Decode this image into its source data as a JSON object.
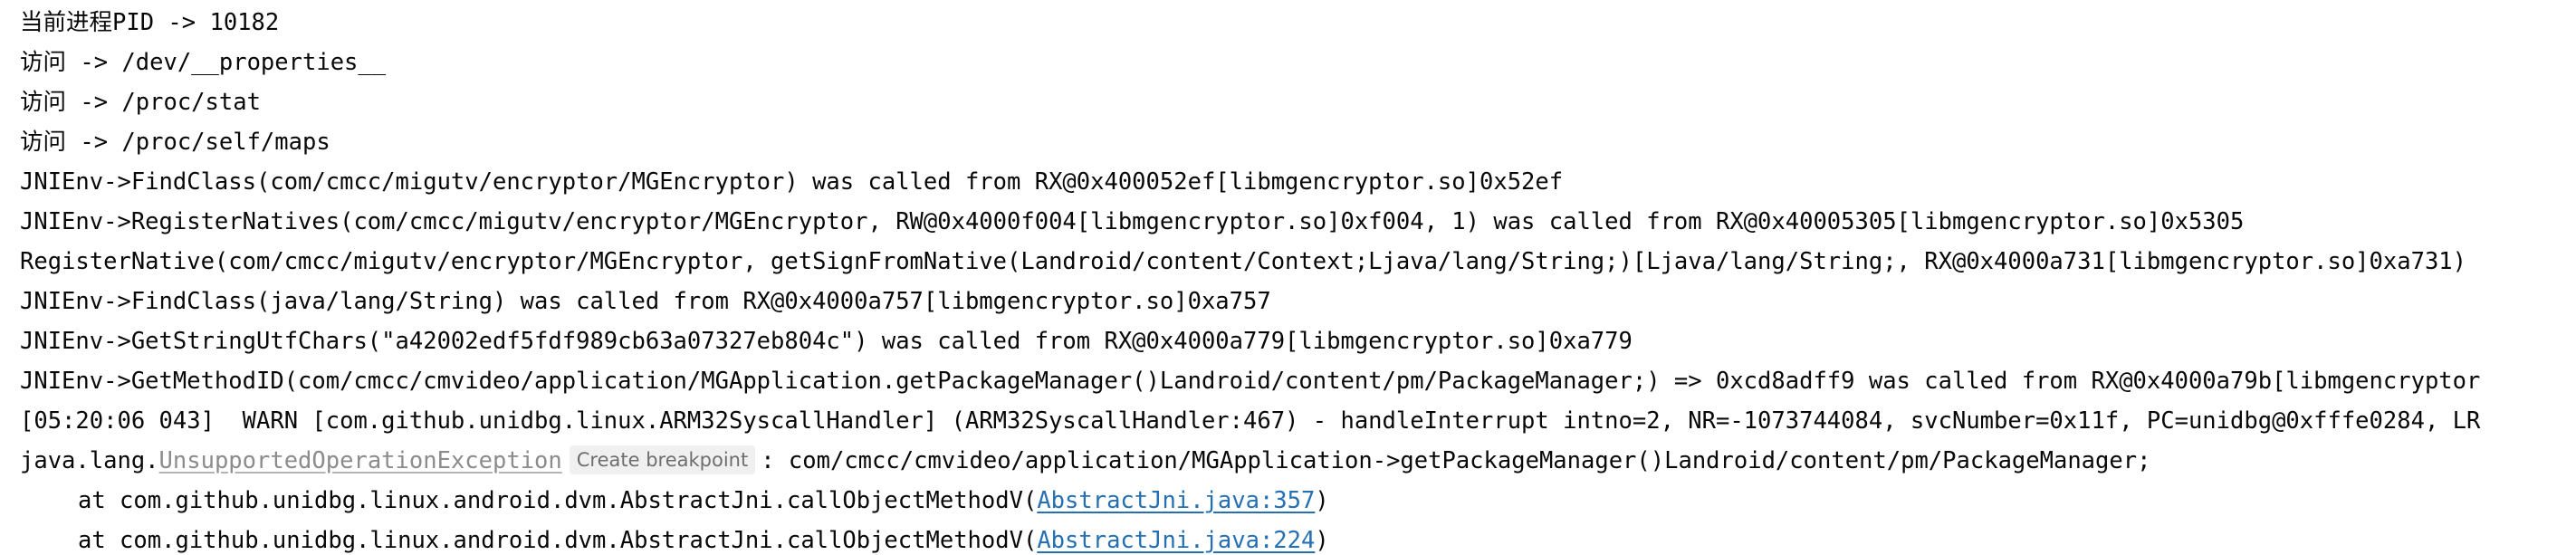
{
  "console": {
    "lines": [
      "当前进程PID -> 10182",
      "访问 -> /dev/__properties__",
      "访问 -> /proc/stat",
      "访问 -> /proc/self/maps",
      "JNIEnv->FindClass(com/cmcc/migutv/encryptor/MGEncryptor) was called from RX@0x400052ef[libmgencryptor.so]0x52ef",
      "JNIEnv->RegisterNatives(com/cmcc/migutv/encryptor/MGEncryptor, RW@0x4000f004[libmgencryptor.so]0xf004, 1) was called from RX@0x40005305[libmgencryptor.so]0x5305",
      "RegisterNative(com/cmcc/migutv/encryptor/MGEncryptor, getSignFromNative(Landroid/content/Context;Ljava/lang/String;)[Ljava/lang/String;, RX@0x4000a731[libmgencryptor.so]0xa731)",
      "JNIEnv->FindClass(java/lang/String) was called from RX@0x4000a757[libmgencryptor.so]0xa757",
      "JNIEnv->GetStringUtfChars(\"a42002edf5fdf989cb63a07327eb804c\") was called from RX@0x4000a779[libmgencryptor.so]0xa779",
      "JNIEnv->GetMethodID(com/cmcc/cmvideo/application/MGApplication.getPackageManager()Landroid/content/pm/PackageManager;) => 0xcd8adff9 was called from RX@0x4000a79b[libmgencryptor",
      "[05:20:06 043]  WARN [com.github.unidbg.linux.ARM32SyscallHandler] (ARM32SyscallHandler:467) - handleInterrupt intno=2, NR=-1073744084, svcNumber=0x11f, PC=unidbg@0xfffe0284, LR"
    ],
    "exception": {
      "prefix": "java.lang.",
      "name": "UnsupportedOperationException",
      "breakpoint_label": "Create breakpoint",
      "message": ": com/cmcc/cmvideo/application/MGApplication->getPackageManager()Landroid/content/pm/PackageManager;"
    },
    "stack": [
      {
        "prefix": "at com.github.unidbg.linux.android.dvm.AbstractJni.callObjectMethodV(",
        "link": "AbstractJni.java:357",
        "suffix": ")"
      },
      {
        "prefix": "at com.github.unidbg.linux.android.dvm.AbstractJni.callObjectMethodV(",
        "link": "AbstractJni.java:224",
        "suffix": ")"
      }
    ]
  }
}
